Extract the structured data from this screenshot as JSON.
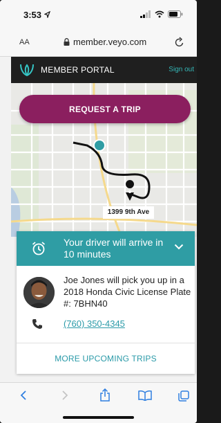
{
  "status_bar": {
    "time": "3:53"
  },
  "browser": {
    "text_size_label": "AA",
    "url": "member.veyo.com"
  },
  "header": {
    "title": "MEMBER PORTAL",
    "signout_label": "Sign out"
  },
  "map": {
    "request_button_label": "REQUEST A TRIP",
    "destination_address": "1399 9th Ave"
  },
  "driver": {
    "eta_message": "Your driver will arrive in 10 minutes",
    "pickup_message": "Joe Jones will pick you up in a 2018 Honda Civic License Plate #: 7BHN40",
    "phone_number": "(760) 350-4345",
    "more_trips_label": "MORE UPCOMING TRIPS"
  },
  "colors": {
    "brand_magenta": "#8b1f5f",
    "teal": "#2f9da4",
    "link_teal": "#2a9aa8",
    "header_dark": "#1f1f1f"
  },
  "icons": [
    "location-arrow-icon",
    "signal-icon",
    "wifi-icon",
    "battery-icon",
    "lock-icon",
    "reload-icon",
    "veyo-logo-icon",
    "alarm-clock-icon",
    "chevron-down-icon",
    "phone-icon",
    "back-icon",
    "forward-icon",
    "share-icon",
    "bookmarks-icon",
    "tabs-icon"
  ]
}
